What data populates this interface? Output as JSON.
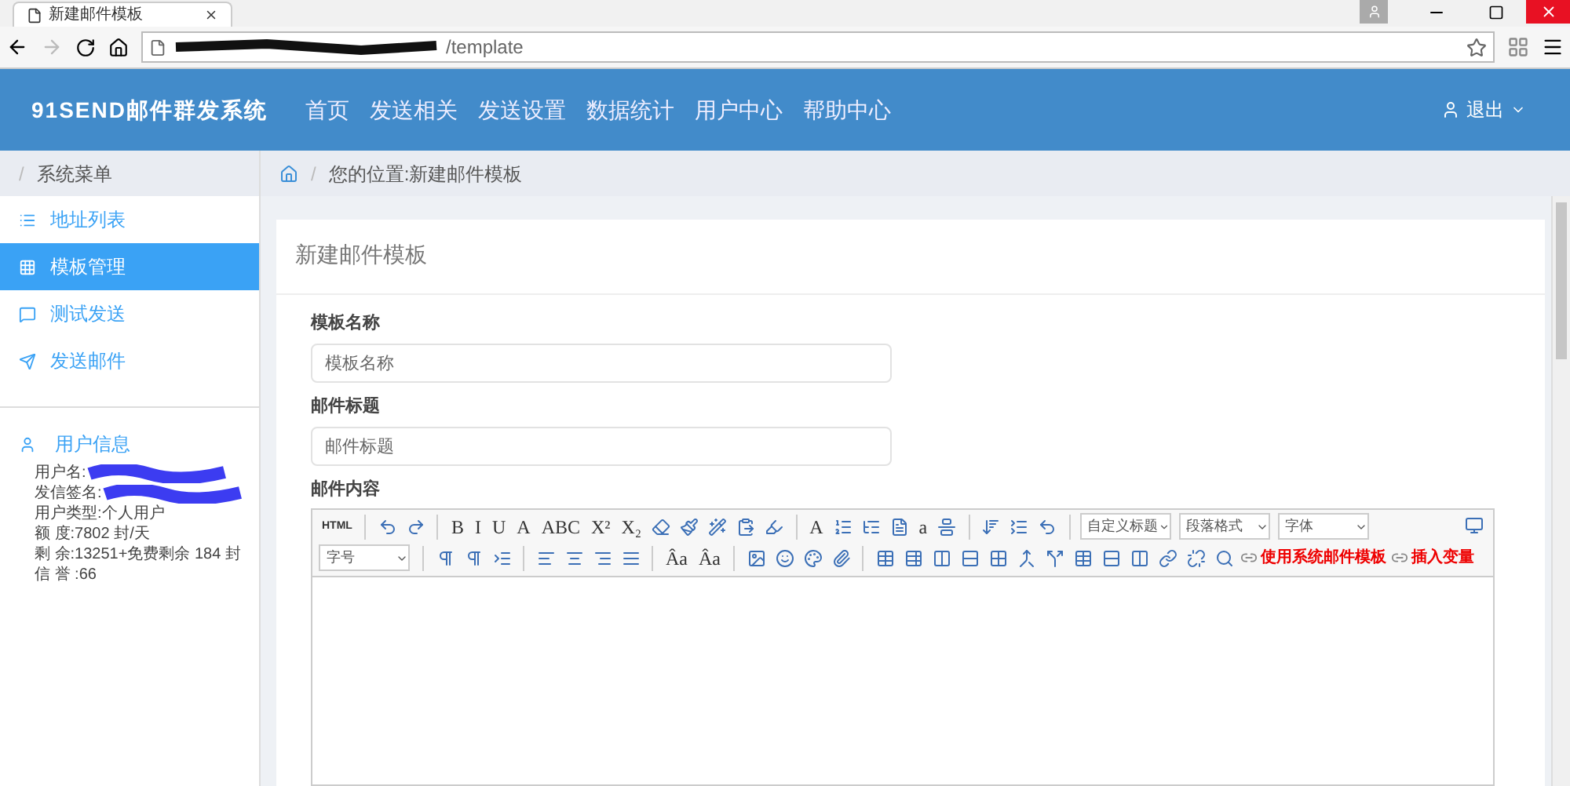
{
  "browser": {
    "tab_title": "新建邮件模板",
    "url_visible": "/template"
  },
  "navbar": {
    "brand": "91SEND邮件群发系统",
    "items": [
      {
        "label": "首页"
      },
      {
        "label": "发送相关"
      },
      {
        "label": "发送设置"
      },
      {
        "label": "数据统计"
      },
      {
        "label": "用户中心"
      },
      {
        "label": "帮助中心"
      }
    ],
    "user_menu": "退出"
  },
  "sidebar": {
    "header_separator": "/",
    "header": "系统菜单",
    "items": [
      {
        "label": "地址列表",
        "selected": false
      },
      {
        "label": "模板管理",
        "selected": true
      },
      {
        "label": "测试发送",
        "selected": false
      },
      {
        "label": "发送邮件",
        "selected": false
      }
    ],
    "user_info": {
      "title": "用户信息",
      "lines": [
        {
          "text": "用户名:",
          "redacted": true
        },
        {
          "text": "发信签名:",
          "redacted": true
        },
        {
          "text": "用户类型:个人用户",
          "redacted": false
        },
        {
          "text": "额 度:7802 封/天",
          "redacted": false
        },
        {
          "text": "剩 余:13251+免费剩余 184 封",
          "redacted": false
        },
        {
          "text": "信 誉 :66",
          "redacted": false
        }
      ]
    }
  },
  "breadcrumb_separator": "/",
  "breadcrumb": "您的位置:新建邮件模板",
  "panel": {
    "title": "新建邮件模板",
    "fields": [
      {
        "label": "模板名称",
        "placeholder": "模板名称"
      },
      {
        "label": "邮件标题",
        "placeholder": "邮件标题"
      }
    ],
    "editor_label": "邮件内容",
    "toolbar_rows": [
      [
        {
          "kind": "glyph",
          "text": "HTML"
        },
        {
          "kind": "sep"
        },
        {
          "kind": "icon"
        },
        {
          "kind": "icon"
        },
        {
          "kind": "sep"
        },
        {
          "kind": "glyph",
          "text": "B"
        },
        {
          "kind": "glyph",
          "text": "I"
        },
        {
          "kind": "glyph",
          "text": "U"
        },
        {
          "kind": "glyph",
          "text": "A"
        },
        {
          "kind": "glyph",
          "text": "ABC"
        },
        {
          "kind": "glyph",
          "text": "X²"
        },
        {
          "kind": "glyph",
          "text": "X₂"
        },
        {
          "kind": "icon"
        },
        {
          "kind": "icon"
        },
        {
          "kind": "icon"
        },
        {
          "kind": "icon"
        },
        {
          "kind": "icon"
        },
        {
          "kind": "sep"
        },
        {
          "kind": "glyph",
          "text": "A"
        },
        {
          "kind": "icon"
        },
        {
          "kind": "icon"
        },
        {
          "kind": "icon"
        },
        {
          "kind": "glyph",
          "text": "a"
        },
        {
          "kind": "icon"
        },
        {
          "kind": "sep"
        },
        {
          "kind": "icon"
        },
        {
          "kind": "icon"
        },
        {
          "kind": "icon"
        },
        {
          "kind": "sep"
        },
        {
          "kind": "select",
          "value": "自定义标题"
        },
        {
          "kind": "select",
          "value": "段落格式"
        },
        {
          "kind": "select",
          "value": "字体"
        }
      ],
      [
        {
          "kind": "select",
          "value": "字号"
        },
        {
          "kind": "sep"
        },
        {
          "kind": "icon"
        },
        {
          "kind": "icon"
        },
        {
          "kind": "icon"
        },
        {
          "kind": "sep"
        },
        {
          "kind": "icon"
        },
        {
          "kind": "icon"
        },
        {
          "kind": "icon"
        },
        {
          "kind": "icon"
        },
        {
          "kind": "sep"
        },
        {
          "kind": "glyph",
          "text": "Âa"
        },
        {
          "kind": "glyph",
          "text": "Âa"
        },
        {
          "kind": "sep"
        },
        {
          "kind": "icon"
        },
        {
          "kind": "icon"
        },
        {
          "kind": "icon"
        },
        {
          "kind": "icon"
        },
        {
          "kind": "sep"
        },
        {
          "kind": "icon"
        },
        {
          "kind": "icon"
        },
        {
          "kind": "icon"
        },
        {
          "kind": "icon"
        },
        {
          "kind": "icon"
        },
        {
          "kind": "icon"
        },
        {
          "kind": "icon"
        },
        {
          "kind": "icon"
        },
        {
          "kind": "icon"
        },
        {
          "kind": "icon"
        },
        {
          "kind": "icon"
        },
        {
          "kind": "icon"
        },
        {
          "kind": "icon"
        },
        {
          "kind": "link",
          "text": "使用系统邮件模板"
        },
        {
          "kind": "link",
          "text": "插入变量"
        }
      ]
    ]
  }
}
